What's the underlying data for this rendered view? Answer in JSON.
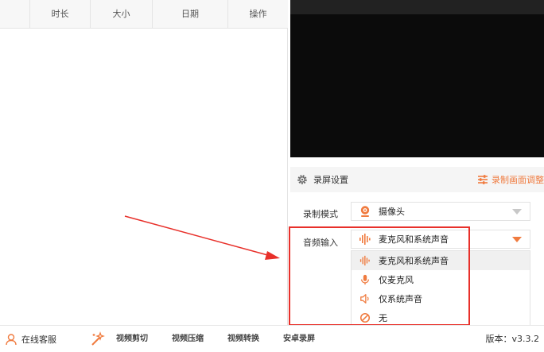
{
  "file_list": {
    "columns": [
      "时长",
      "大小",
      "日期",
      "操作"
    ]
  },
  "settings": {
    "title": "录屏设置",
    "adjust_link": "录制画面调整",
    "record_mode": {
      "label": "录制模式",
      "value": "摄像头",
      "icon": "camera-icon"
    },
    "audio_input": {
      "label": "音频输入",
      "value": "麦克风和系统声音",
      "icon": "sound-wave-icon",
      "options": [
        {
          "label": "麦克风和系统声音",
          "icon": "sound-wave-icon",
          "selected": true
        },
        {
          "label": "仅麦克风",
          "icon": "microphone-icon",
          "selected": false
        },
        {
          "label": "仅系统声音",
          "icon": "speaker-icon",
          "selected": false
        },
        {
          "label": "无",
          "icon": "mute-icon",
          "selected": false
        }
      ]
    }
  },
  "bottom_bar": {
    "support": "在线客服",
    "tools": [
      "视频剪切",
      "视频压缩",
      "视频转换",
      "安卓录屏"
    ],
    "version": "版本：v3.3.2"
  },
  "colors": {
    "accent": "#f07b3f",
    "annotation": "#e8302a",
    "preview_bg": "#0b0b0b"
  }
}
